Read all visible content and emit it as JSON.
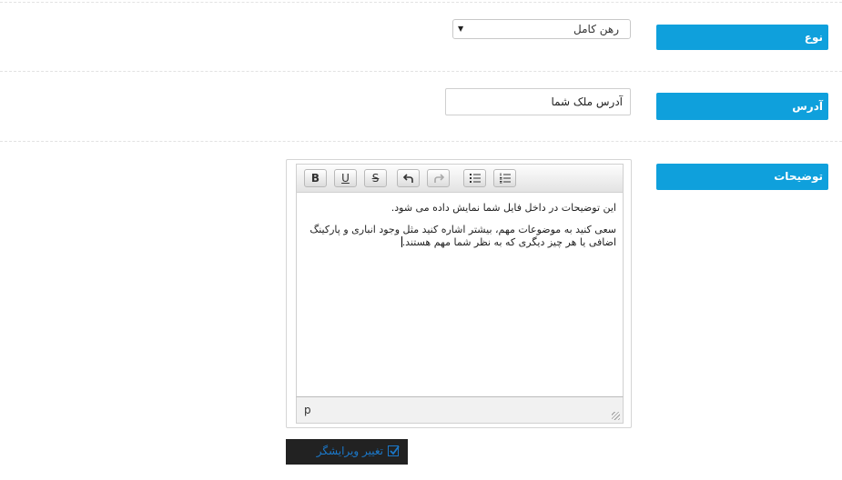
{
  "form": {
    "type_field": {
      "label": "نوع",
      "value": "رهن کامل"
    },
    "address_field": {
      "label": "آدرس",
      "value": "آدرس ملک شما"
    },
    "description_field": {
      "label": "توضیحات",
      "toolbar": {
        "bold": "B",
        "underline": "U",
        "strikethrough": "S",
        "undo_icon": "undo-icon",
        "redo_icon": "redo-icon",
        "bullet_list_icon": "bullet-list-icon",
        "numbered_list_icon": "numbered-list-icon"
      },
      "paragraphs": [
        "این توضیحات در داخل فایل شما نمایش داده می شود.",
        "سعی کنید به موضوعات مهم، بیشتر اشاره کنید مثل وجود انباری و پارکینگ اضافی یا هر چیز دیگری که به نظر شما مهم هستند."
      ],
      "status_path": "p"
    },
    "toggle_editor": {
      "label": "تغییر ویرایشگر",
      "checked": true
    }
  }
}
